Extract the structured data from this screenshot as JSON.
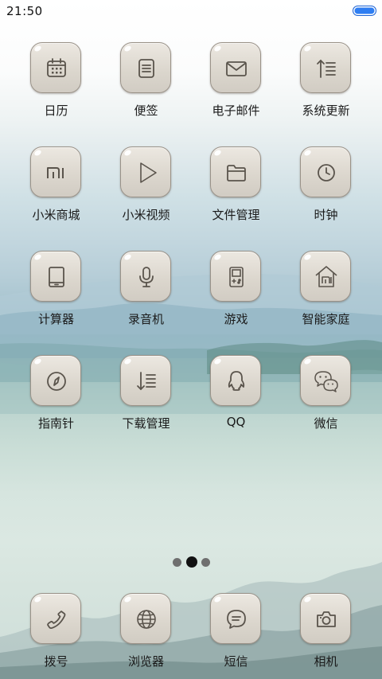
{
  "status_bar": {
    "time": "21:50"
  },
  "apps": [
    {
      "label": "日历",
      "icon": "calendar-icon"
    },
    {
      "label": "便签",
      "icon": "notes-icon"
    },
    {
      "label": "电子邮件",
      "icon": "mail-icon"
    },
    {
      "label": "系统更新",
      "icon": "update-icon"
    },
    {
      "label": "小米商城",
      "icon": "mi-store-icon"
    },
    {
      "label": "小米视频",
      "icon": "play-icon"
    },
    {
      "label": "文件管理",
      "icon": "folder-icon"
    },
    {
      "label": "时钟",
      "icon": "clock-icon"
    },
    {
      "label": "计算器",
      "icon": "calculator-icon"
    },
    {
      "label": "录音机",
      "icon": "microphone-icon"
    },
    {
      "label": "游戏",
      "icon": "game-icon"
    },
    {
      "label": "智能家庭",
      "icon": "smart-home-icon"
    },
    {
      "label": "指南针",
      "icon": "compass-icon"
    },
    {
      "label": "下载管理",
      "icon": "download-icon"
    },
    {
      "label": "QQ",
      "icon": "qq-icon"
    },
    {
      "label": "微信",
      "icon": "wechat-icon"
    }
  ],
  "page_indicator": {
    "pages": 3,
    "current": 2
  },
  "dock": [
    {
      "label": "拨号",
      "icon": "phone-icon"
    },
    {
      "label": "浏览器",
      "icon": "browser-icon"
    },
    {
      "label": "短信",
      "icon": "message-icon"
    },
    {
      "label": "相机",
      "icon": "camera-icon"
    }
  ]
}
